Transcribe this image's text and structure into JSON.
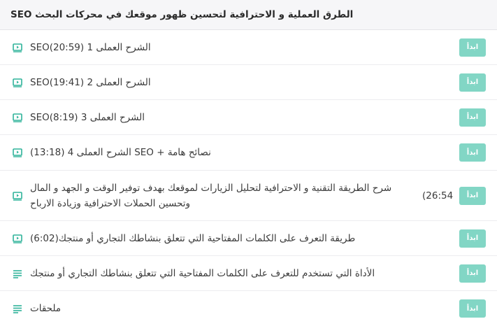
{
  "section": {
    "title": "SEO الطرق العملية و الاحترافية لتحسين ظهور موقعك في محركات البحث"
  },
  "accent_color": "#82d6c5",
  "lectures": [
    {
      "icon": "video-play-icon",
      "title": "الشرح العملى 1 SEO(20:59)",
      "duration": "",
      "button": "ابدأ"
    },
    {
      "icon": "video-play-icon",
      "title": "الشرح العملى 2 SEO(19:41)",
      "duration": "",
      "button": "ابدأ"
    },
    {
      "icon": "video-play-icon",
      "title": "الشرح العملى 3 SEO(8:19)",
      "duration": "",
      "button": "ابدأ"
    },
    {
      "icon": "video-play-icon",
      "title": "نصائح هامة + SEO الشرح العملى 4 (13:18)",
      "duration": "",
      "button": "ابدأ"
    },
    {
      "icon": "video-play-icon",
      "title": "شرح الطريقة التقنية و الاحترافية لتحليل الزيارات لموقعك بهدف توفير الوقت و الجهد و المال وتحسين الحملات الاحترافية وزيادة الارباح",
      "duration": "(26:54",
      "button": "ابدأ"
    },
    {
      "icon": "video-play-icon",
      "title": "طريقة التعرف على الكلمات المفتاحية التي تتعلق بنشاطك التجاري أو منتجك(6:02)",
      "duration": "",
      "button": "ابدأ"
    },
    {
      "icon": "text-lines-icon",
      "title": "الأداة التي تستخدم للتعرف على الكلمات المفتاحية التي تتعلق بنشاطك التجاري أو منتجك",
      "duration": "",
      "button": "ابدأ"
    },
    {
      "icon": "text-lines-icon",
      "title": "ملحقات",
      "duration": "",
      "button": "ابدأ"
    }
  ]
}
